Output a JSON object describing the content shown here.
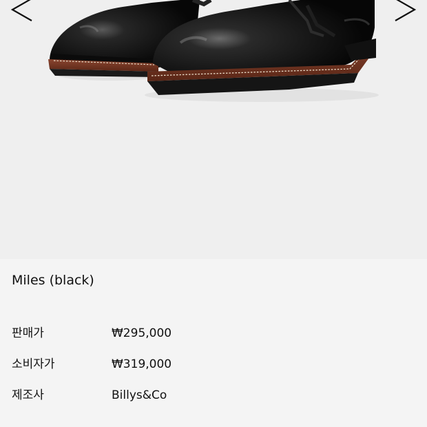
{
  "product": {
    "name": "Miles (black)"
  },
  "specs": [
    {
      "label": "판매가",
      "value": "₩295,000"
    },
    {
      "label": "소비자가",
      "value": "₩319,000"
    },
    {
      "label": "제조사",
      "value": "Billys&Co"
    }
  ],
  "gallery": {
    "prev_icon": "chevron-left-icon",
    "next_icon": "chevron-right-icon",
    "image_subject": "black leather shoes"
  },
  "colors": {
    "background": "#f4f4f4",
    "gallery_background": "#efefef",
    "text": "#111111",
    "leather": "#0e0e0e",
    "welt": "#7a3a26"
  }
}
